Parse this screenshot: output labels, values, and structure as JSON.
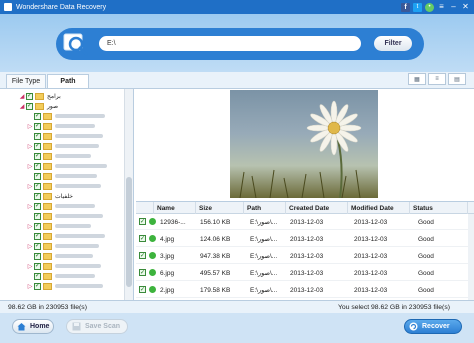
{
  "window": {
    "title": "Wondershare Data Recovery"
  },
  "header": {
    "path_value": "E:\\",
    "filter_label": "Filter"
  },
  "tabs": [
    {
      "label": "File Type"
    },
    {
      "label": "Path"
    }
  ],
  "tree": {
    "items": [
      {
        "label": "برامج"
      },
      {
        "label": "صور"
      },
      {
        "label": "خلفيات"
      }
    ]
  },
  "table": {
    "headers": {
      "name": "Name",
      "size": "Size",
      "path": "Path",
      "created": "Created Date",
      "modified": "Modified Date",
      "status": "Status"
    },
    "rows": [
      {
        "name": "12936-...",
        "size": "156.10 KB",
        "path": "E:\\صور\\...",
        "created": "2013-12-03",
        "modified": "2013-12-03",
        "status": "Good"
      },
      {
        "name": "4.jpg",
        "size": "124.06 KB",
        "path": "E:\\صور\\...",
        "created": "2013-12-03",
        "modified": "2013-12-03",
        "status": "Good"
      },
      {
        "name": "3.jpg",
        "size": "947.38 KB",
        "path": "E:\\صور\\...",
        "created": "2013-12-03",
        "modified": "2013-12-03",
        "status": "Good"
      },
      {
        "name": "6.jpg",
        "size": "495.57 KB",
        "path": "E:\\صور\\...",
        "created": "2013-12-03",
        "modified": "2013-12-03",
        "status": "Good"
      },
      {
        "name": "2.jpg",
        "size": "179.58 KB",
        "path": "E:\\صور\\...",
        "created": "2013-12-03",
        "modified": "2013-12-03",
        "status": "Good"
      }
    ]
  },
  "statusbar": {
    "left": "98.62 GB in 230953 file(s)",
    "right": "You select 98.62 GB in 230953 file(s)"
  },
  "buttons": {
    "home": "Home",
    "save_scan": "Save Scan",
    "recover": "Recover"
  },
  "colors": {
    "accent": "#2d7fd3",
    "titlebar": "#1f6fc6",
    "check": "#3a8a3a",
    "status_good": "#3db33d"
  }
}
